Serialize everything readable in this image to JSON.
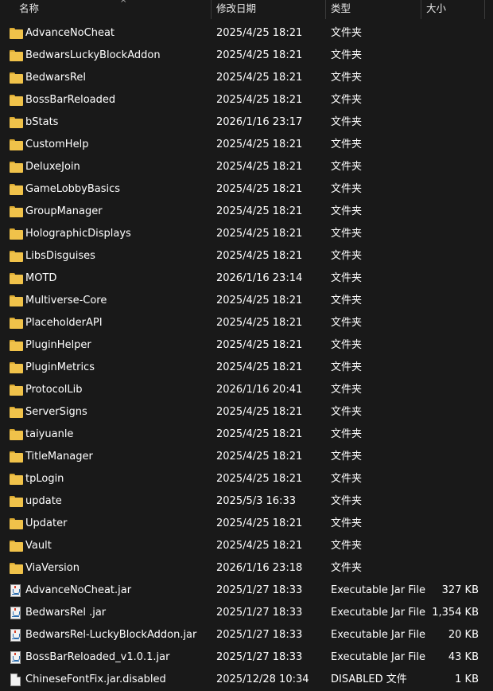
{
  "columns": {
    "name": "名称",
    "date": "修改日期",
    "type": "类型",
    "size": "大小"
  },
  "files": [
    {
      "name": "AdvanceNoCheat",
      "date": "2025/4/25 18:21",
      "type": "文件夹",
      "size": "",
      "icon": "folder-icon"
    },
    {
      "name": "BedwarsLuckyBlockAddon",
      "date": "2025/4/25 18:21",
      "type": "文件夹",
      "size": "",
      "icon": "folder-icon"
    },
    {
      "name": "BedwarsRel",
      "date": "2025/4/25 18:21",
      "type": "文件夹",
      "size": "",
      "icon": "folder-icon"
    },
    {
      "name": "BossBarReloaded",
      "date": "2025/4/25 18:21",
      "type": "文件夹",
      "size": "",
      "icon": "folder-icon"
    },
    {
      "name": "bStats",
      "date": "2026/1/16 23:17",
      "type": "文件夹",
      "size": "",
      "icon": "folder-icon"
    },
    {
      "name": "CustomHelp",
      "date": "2025/4/25 18:21",
      "type": "文件夹",
      "size": "",
      "icon": "folder-icon"
    },
    {
      "name": "DeluxeJoin",
      "date": "2025/4/25 18:21",
      "type": "文件夹",
      "size": "",
      "icon": "folder-icon"
    },
    {
      "name": "GameLobbyBasics",
      "date": "2025/4/25 18:21",
      "type": "文件夹",
      "size": "",
      "icon": "folder-icon"
    },
    {
      "name": "GroupManager",
      "date": "2025/4/25 18:21",
      "type": "文件夹",
      "size": "",
      "icon": "folder-icon"
    },
    {
      "name": "HolographicDisplays",
      "date": "2025/4/25 18:21",
      "type": "文件夹",
      "size": "",
      "icon": "folder-icon"
    },
    {
      "name": "LibsDisguises",
      "date": "2025/4/25 18:21",
      "type": "文件夹",
      "size": "",
      "icon": "folder-icon"
    },
    {
      "name": "MOTD",
      "date": "2026/1/16 23:14",
      "type": "文件夹",
      "size": "",
      "icon": "folder-icon"
    },
    {
      "name": "Multiverse-Core",
      "date": "2025/4/25 18:21",
      "type": "文件夹",
      "size": "",
      "icon": "folder-icon"
    },
    {
      "name": "PlaceholderAPI",
      "date": "2025/4/25 18:21",
      "type": "文件夹",
      "size": "",
      "icon": "folder-icon"
    },
    {
      "name": "PluginHelper",
      "date": "2025/4/25 18:21",
      "type": "文件夹",
      "size": "",
      "icon": "folder-icon"
    },
    {
      "name": "PluginMetrics",
      "date": "2025/4/25 18:21",
      "type": "文件夹",
      "size": "",
      "icon": "folder-icon"
    },
    {
      "name": "ProtocolLib",
      "date": "2026/1/16 20:41",
      "type": "文件夹",
      "size": "",
      "icon": "folder-icon"
    },
    {
      "name": "ServerSigns",
      "date": "2025/4/25 18:21",
      "type": "文件夹",
      "size": "",
      "icon": "folder-icon"
    },
    {
      "name": "taiyuanle",
      "date": "2025/4/25 18:21",
      "type": "文件夹",
      "size": "",
      "icon": "folder-icon"
    },
    {
      "name": "TitleManager",
      "date": "2025/4/25 18:21",
      "type": "文件夹",
      "size": "",
      "icon": "folder-icon"
    },
    {
      "name": "tpLogin",
      "date": "2025/4/25 18:21",
      "type": "文件夹",
      "size": "",
      "icon": "folder-icon"
    },
    {
      "name": "update",
      "date": "2025/5/3 16:33",
      "type": "文件夹",
      "size": "",
      "icon": "folder-icon"
    },
    {
      "name": "Updater",
      "date": "2025/4/25 18:21",
      "type": "文件夹",
      "size": "",
      "icon": "folder-icon"
    },
    {
      "name": "Vault",
      "date": "2025/4/25 18:21",
      "type": "文件夹",
      "size": "",
      "icon": "folder-icon"
    },
    {
      "name": "ViaVersion",
      "date": "2026/1/16 23:18",
      "type": "文件夹",
      "size": "",
      "icon": "folder-icon"
    },
    {
      "name": "AdvanceNoCheat.jar",
      "date": "2025/1/27 18:33",
      "type": "Executable Jar File",
      "size": "327 KB",
      "icon": "jar-file-icon"
    },
    {
      "name": "BedwarsRel .jar",
      "date": "2025/1/27 18:33",
      "type": "Executable Jar File",
      "size": "1,354 KB",
      "icon": "jar-file-icon"
    },
    {
      "name": "BedwarsRel-LuckyBlockAddon.jar",
      "date": "2025/1/27 18:33",
      "type": "Executable Jar File",
      "size": "20 KB",
      "icon": "jar-file-icon"
    },
    {
      "name": "BossBarReloaded_v1.0.1.jar",
      "date": "2025/1/27 18:33",
      "type": "Executable Jar File",
      "size": "43 KB",
      "icon": "jar-file-icon"
    },
    {
      "name": "ChineseFontFix.jar.disabled",
      "date": "2025/12/28 10:34",
      "type": "DISABLED 文件",
      "size": "1 KB",
      "icon": "file-icon"
    }
  ],
  "colors": {
    "background": "#191919",
    "text": "#ffffff",
    "folder": "#f0c24a"
  }
}
